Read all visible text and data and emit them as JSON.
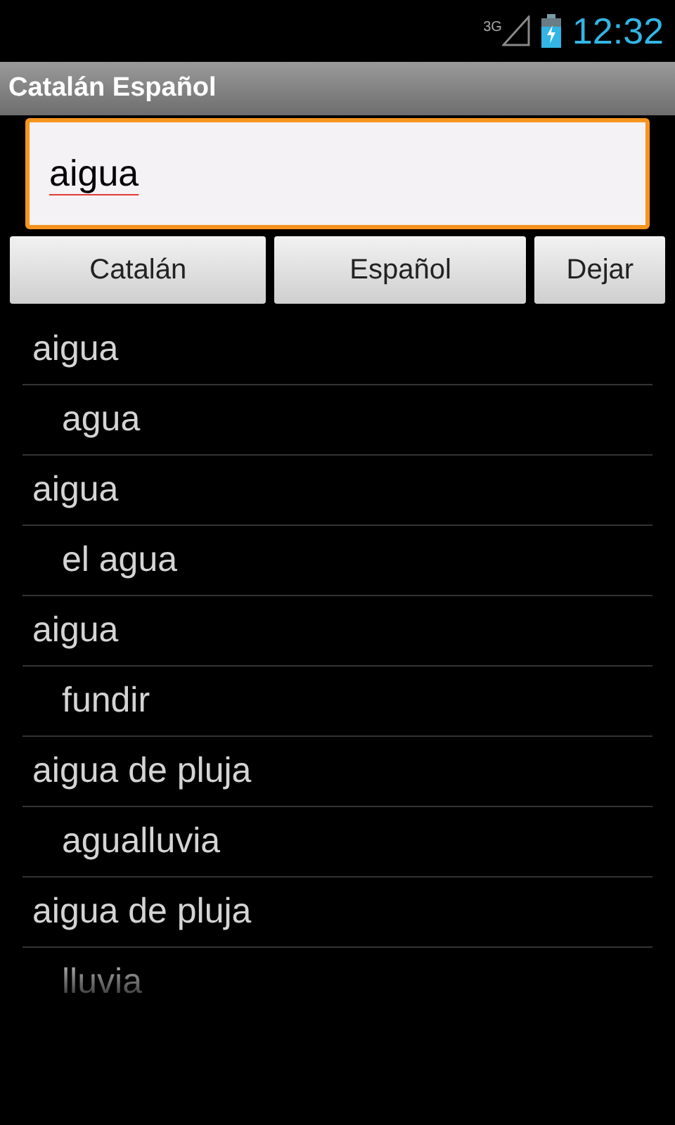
{
  "status_bar": {
    "network": "3G",
    "time": "12:32"
  },
  "title_bar": {
    "title": "Catalán Español"
  },
  "search": {
    "value": "aigua"
  },
  "buttons": [
    "Catalán",
    "Español",
    "Dejar"
  ],
  "results": [
    {
      "kind": "term",
      "text": "aigua"
    },
    {
      "kind": "translation",
      "text": "agua"
    },
    {
      "kind": "term",
      "text": "aigua"
    },
    {
      "kind": "translation",
      "text": "el agua"
    },
    {
      "kind": "term",
      "text": "aigua"
    },
    {
      "kind": "translation",
      "text": "fundir"
    },
    {
      "kind": "term",
      "text": "aigua de pluja"
    },
    {
      "kind": "translation",
      "text": "agualluvia"
    },
    {
      "kind": "term",
      "text": "aigua de pluja"
    },
    {
      "kind": "translation",
      "text": "lluvia"
    }
  ]
}
